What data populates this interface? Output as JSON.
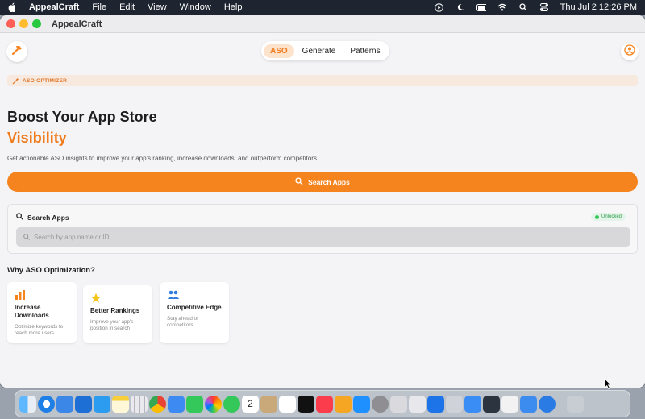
{
  "menubar": {
    "app_name": "AppealCraft",
    "items": [
      "File",
      "Edit",
      "View",
      "Window",
      "Help"
    ],
    "datetime": "Thu Jul 2  12:26 PM"
  },
  "window": {
    "title": "AppealCraft"
  },
  "nav": {
    "tabs": [
      "ASO",
      "Generate",
      "Patterns"
    ],
    "active_tab": "ASO"
  },
  "hero": {
    "badge": "ASO OPTIMIZER",
    "title": "Boost Your App Store",
    "title_accent": "Visibility",
    "subtitle": "Get actionable ASO insights to improve your app's ranking, increase downloads, and outperform competitors.",
    "cta_label": "Search Apps"
  },
  "search": {
    "heading": "Search Apps",
    "status": "Unlocked",
    "placeholder": "Search by app name or ID..."
  },
  "why": {
    "title": "Why ASO Optimization?",
    "cards": [
      {
        "icon": "bar-chart-icon",
        "title": "Increase Downloads",
        "description": "Optimize keywords to reach more users"
      },
      {
        "icon": "star-icon",
        "title": "Better Rankings",
        "description": "Improve your app's position in search"
      },
      {
        "icon": "people-icon",
        "title": "Competitive Edge",
        "description": "Stay ahead of competitors"
      }
    ]
  },
  "dock": {
    "calendar_day": "2",
    "icons": [
      "finder",
      "safari",
      "files",
      "xcode",
      "vscode",
      "notes",
      "launchpad",
      "chrome",
      "mail",
      "facetime",
      "photos",
      "messages",
      "calendar",
      "contacts",
      "reminders",
      "tv",
      "music",
      "pages",
      "app-store",
      "settings",
      "preview",
      "utility",
      "transporter",
      "apple",
      "instruments",
      "simulator",
      "instruments-2",
      "simulator-2",
      "xcode-2",
      "trash"
    ]
  },
  "colors": {
    "accent": "#F5841F",
    "accent_text": "#F07B1D",
    "success": "#34C759"
  }
}
